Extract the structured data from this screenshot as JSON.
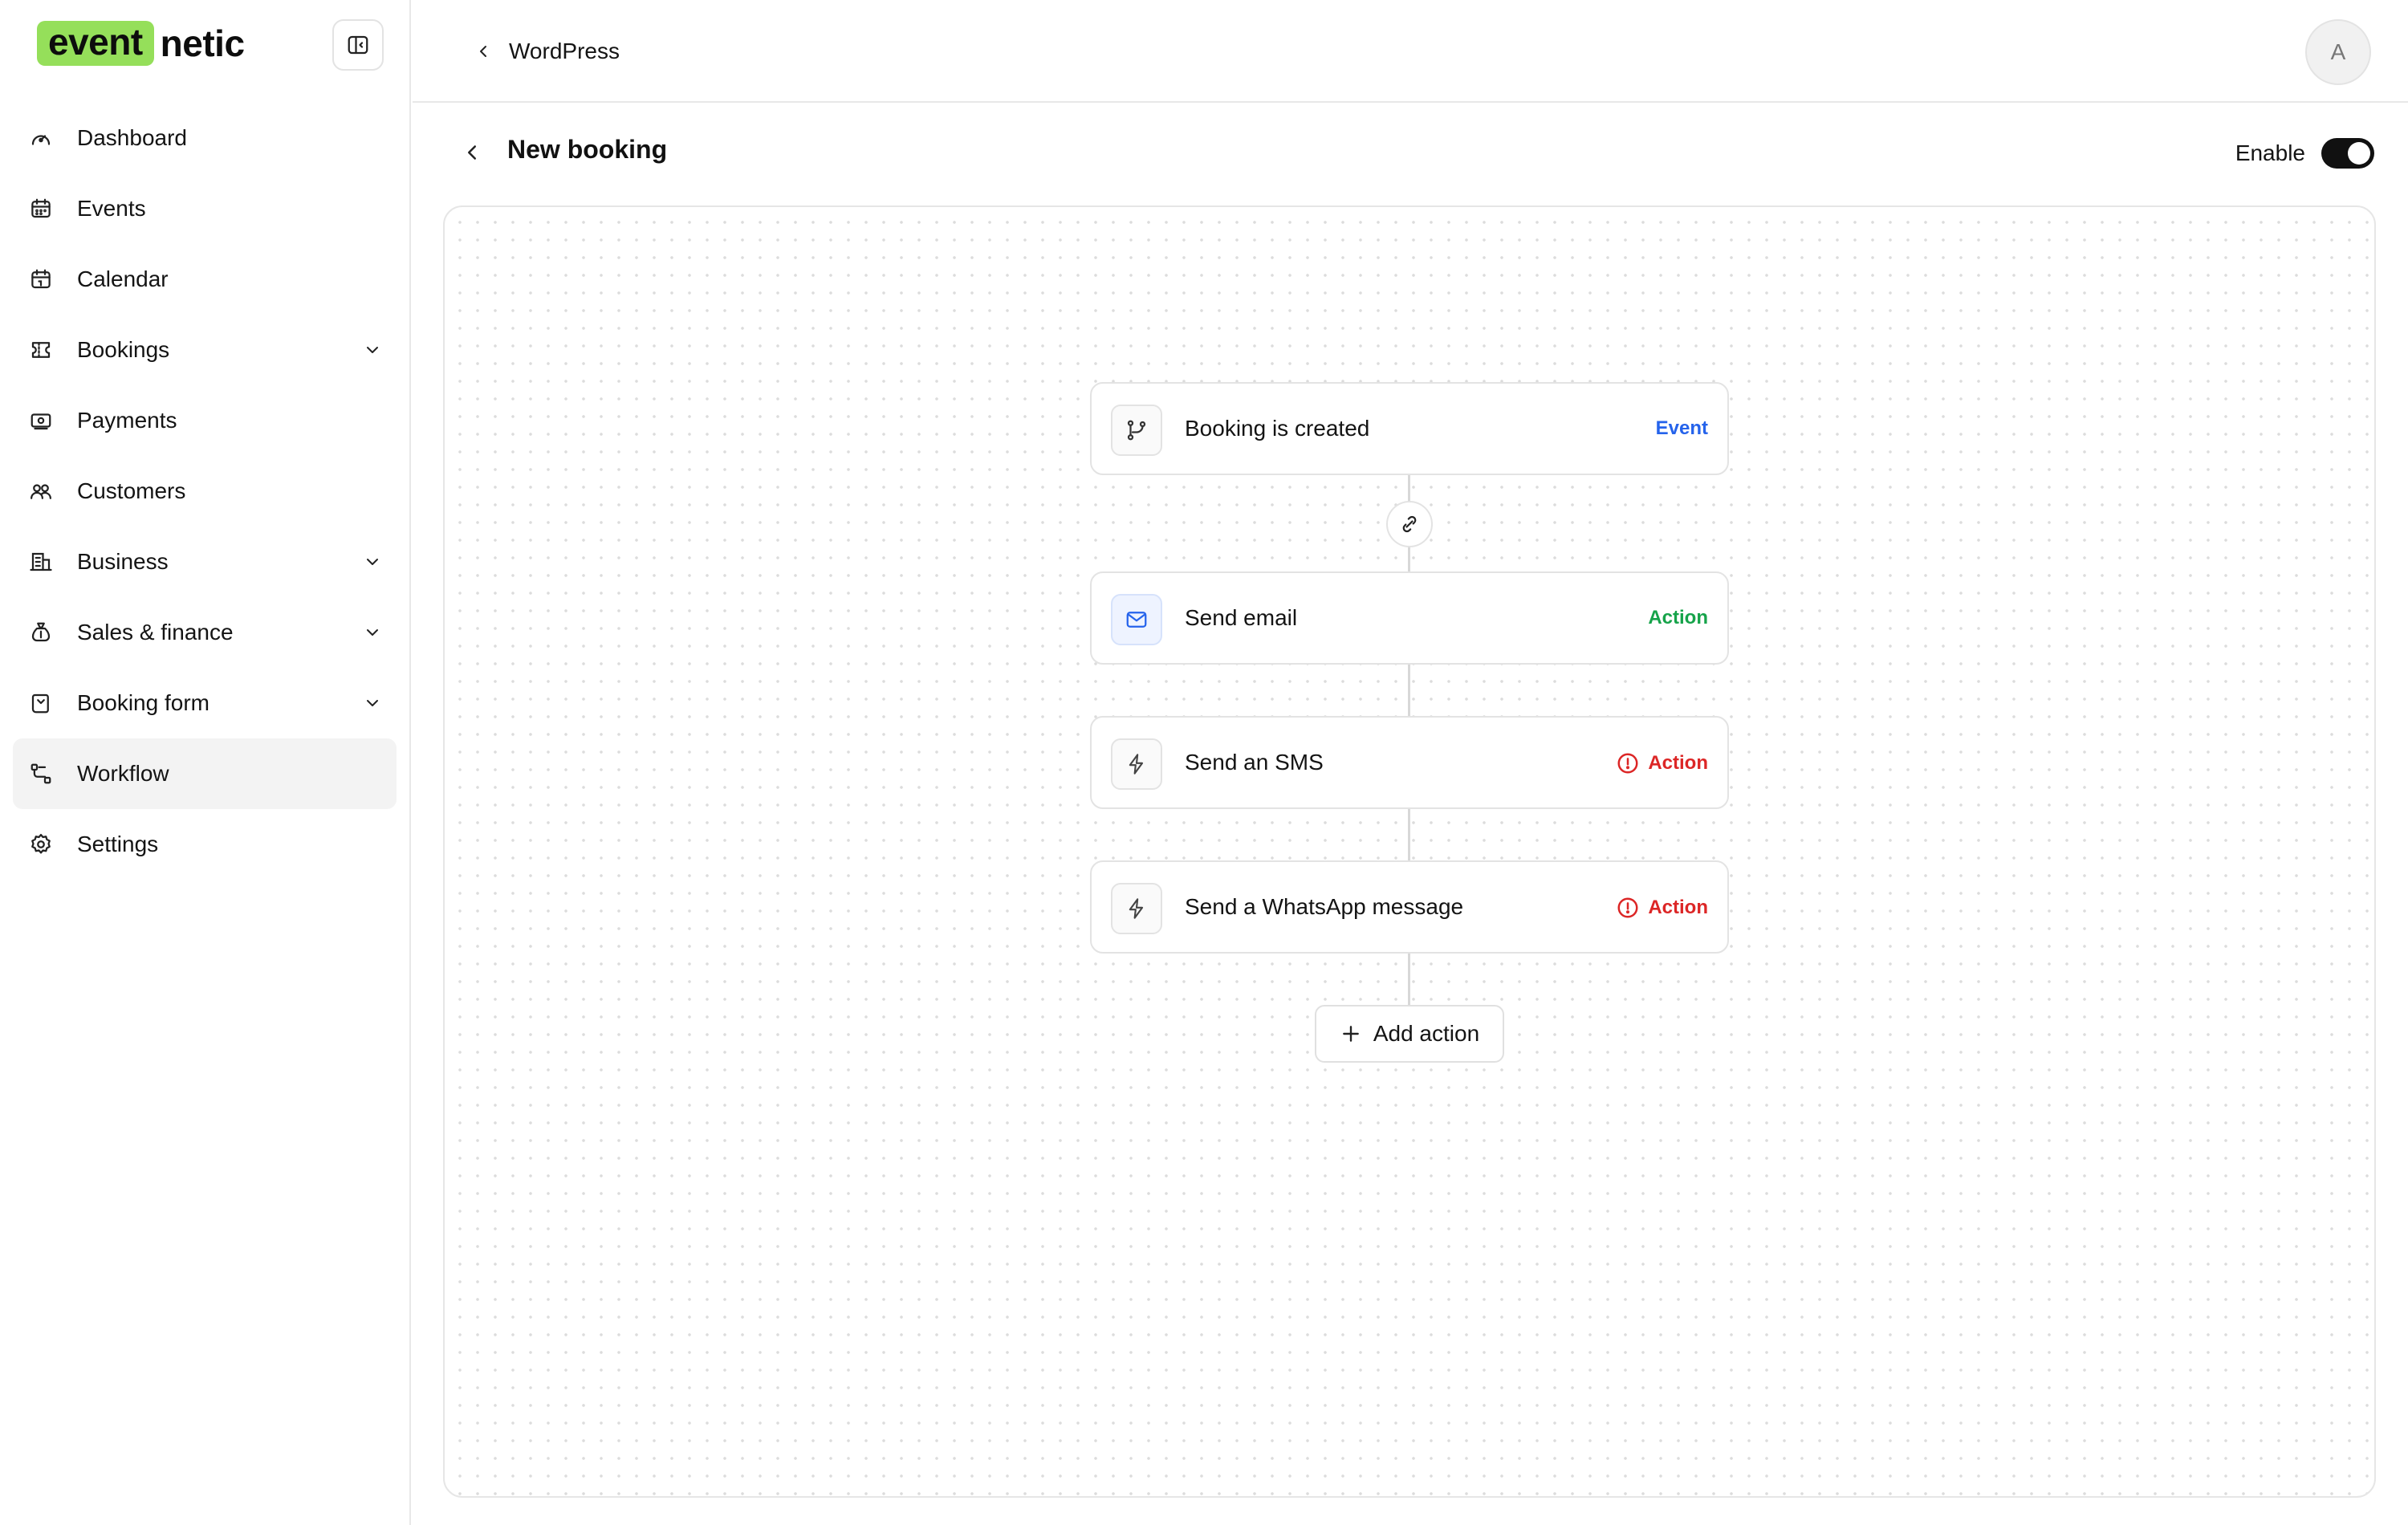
{
  "brand": {
    "logo_highlight": "event",
    "logo_rest": "netic",
    "accent": "#95df5a"
  },
  "sidebar": {
    "items": [
      {
        "label": "Dashboard",
        "icon": "gauge-icon"
      },
      {
        "label": "Events",
        "icon": "calendar-grid-icon"
      },
      {
        "label": "Calendar",
        "icon": "calendar-icon"
      },
      {
        "label": "Bookings",
        "icon": "ticket-icon",
        "has_chevron": true
      },
      {
        "label": "Payments",
        "icon": "banknote-icon"
      },
      {
        "label": "Customers",
        "icon": "users-icon"
      },
      {
        "label": "Business",
        "icon": "building-icon",
        "has_chevron": true
      },
      {
        "label": "Sales & finance",
        "icon": "money-bag-icon",
        "has_chevron": true
      },
      {
        "label": "Booking form",
        "icon": "form-icon",
        "has_chevron": true
      },
      {
        "label": "Workflow",
        "icon": "workflow-icon",
        "active": true
      },
      {
        "label": "Settings",
        "icon": "gear-icon"
      }
    ]
  },
  "header": {
    "breadcrumb": "WordPress",
    "avatar_initial": "A"
  },
  "page": {
    "title": "New booking",
    "enable_label": "Enable",
    "enabled": true
  },
  "workflow": {
    "nodes": [
      {
        "title": "Booking is created",
        "tag": "Event",
        "tag_color": "#2563eb",
        "icon": "git-branch-icon",
        "warning": false
      },
      {
        "title": "Send email",
        "tag": "Action",
        "tag_color": "#16a34a",
        "icon": "mail-icon",
        "warning": false
      },
      {
        "title": "Send an SMS",
        "tag": "Action",
        "tag_color": "#dc2626",
        "icon": "lightning-icon",
        "warning": true
      },
      {
        "title": "Send a WhatsApp message",
        "tag": "Action",
        "tag_color": "#dc2626",
        "icon": "lightning-icon",
        "warning": true
      }
    ],
    "add_action_label": "Add action"
  }
}
